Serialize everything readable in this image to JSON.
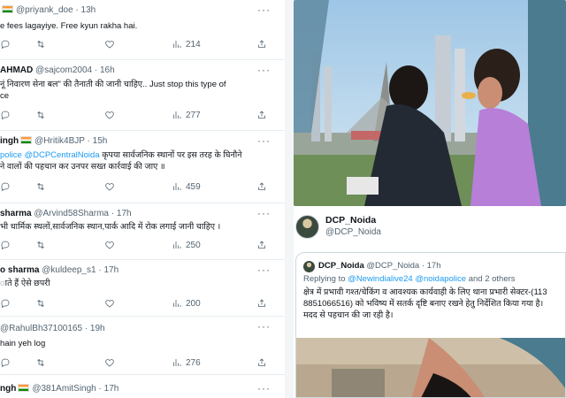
{
  "tweets": [
    {
      "name": "",
      "flag": true,
      "handle": "@priyank_doe",
      "time": "· 13h",
      "lines": [
        {
          "pre": "e fees lagayiye. Free kyun rakha hai.",
          "link": "",
          "post": ""
        }
      ],
      "views": "214"
    },
    {
      "name": "AHMAD",
      "flag": false,
      "handle": "@sajcom2004",
      "time": "· 16h",
      "lines": [
        {
          "pre": "नूं निवारण सेना बल\" की तैनाती की जानी चाहिए.. Just stop this type of",
          "link": "",
          "post": ""
        },
        {
          "pre": "ce",
          "link": "",
          "post": ""
        }
      ],
      "views": "277"
    },
    {
      "name": "ingh",
      "flag": true,
      "handle": "@Hritik4BJP",
      "time": "· 15h",
      "lines": [
        {
          "pre": "",
          "link": "police @DCPCentralNoida",
          "post": " कृपया सार्वजनिक स्थानों पर इस तरह के घिनौने"
        },
        {
          "pre": "ने वालों की पहचान कर उनपर सख्त कार्रवाई की जाए ॥",
          "link": "",
          "post": ""
        }
      ],
      "views": "459"
    },
    {
      "name": "sharma",
      "flag": false,
      "handle": "@Arvind58Sharma",
      "time": "· 17h",
      "lines": [
        {
          "pre": "भी धार्मिक स्थलों,सार्वजनिक स्थान,पार्क आदि में रोक लगाई जानी चाहिए ।",
          "link": "",
          "post": ""
        }
      ],
      "views": "250"
    },
    {
      "name": "o sharma",
      "flag": false,
      "handle": "@kuldeep_s1",
      "time": "· 17h",
      "lines": [
        {
          "pre": "ाते हैं ऐसे छपरी",
          "link": "",
          "post": ""
        }
      ],
      "views": "200"
    },
    {
      "name": "",
      "flag": false,
      "handle": "@RahulBh37100165",
      "time": "· 19h",
      "lines": [
        {
          "pre": "hain yeh log",
          "link": "",
          "post": ""
        }
      ],
      "views": "276"
    },
    {
      "name": "ngh",
      "flag": true,
      "handle": "@381AmitSingh",
      "time": "· 17h",
      "lines": [],
      "views": ""
    }
  ],
  "author": {
    "name": "DCP_Noida",
    "handle": "@DCP_Noida"
  },
  "quote": {
    "name": "DCP_Noida",
    "handle": "@DCP_Noida",
    "time": "· 17h",
    "reply_prefix": "Replying to ",
    "reply_link": "@Newindialive24 @noidapolice",
    "reply_suffix": " and 2 others",
    "lines": [
      "क्षेत्र में प्रभावी गश्त/चेकिंग व आवश्यक कार्यवाही के लिए थाना प्रभारी सेक्टर-(113",
      "8851066516) को भविष्य में सतर्क दृष्टि बनाए रखने हेतु निर्देशित किया गया है।",
      "मदद से पहचान की जा रही है।"
    ]
  },
  "icons": {
    "reply": "reply-icon",
    "retweet": "retweet-icon",
    "like": "heart-icon",
    "views": "views-icon",
    "share": "share-icon",
    "more": "more-icon"
  },
  "colors": {
    "link": "#1d9bf0",
    "secondary": "#536471",
    "border": "#e6ecf0"
  }
}
